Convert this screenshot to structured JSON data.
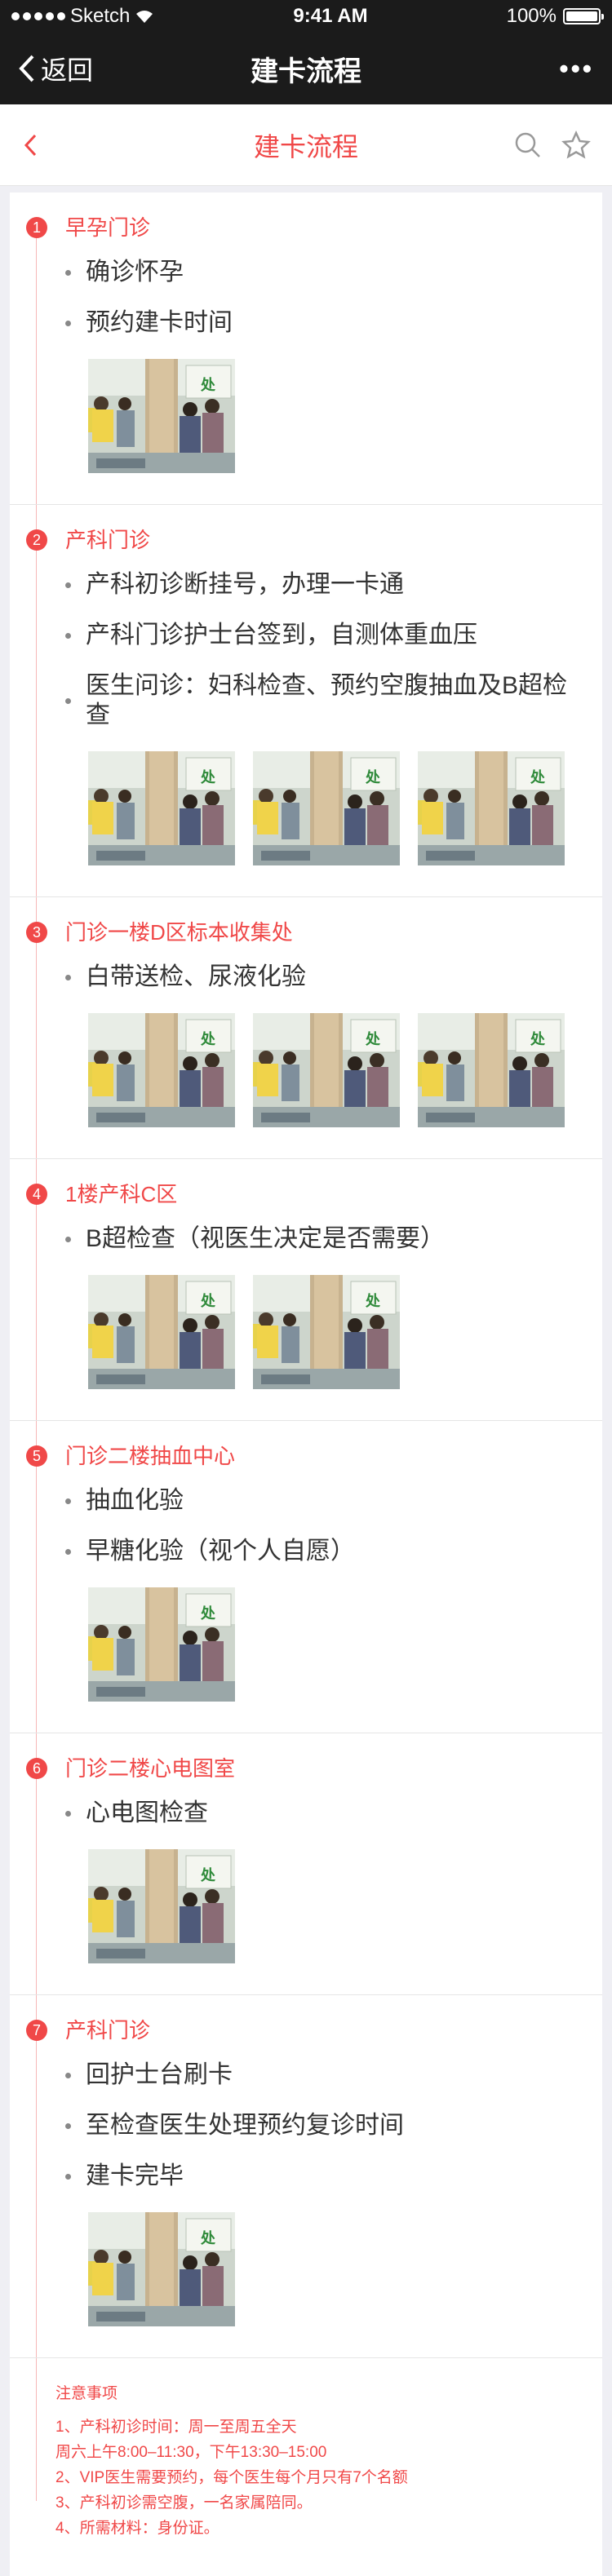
{
  "status": {
    "carrier": "Sketch",
    "time": "9:41 AM",
    "battery": "100%"
  },
  "wechat": {
    "back_label": "返回",
    "title": "建卡流程",
    "more_label": "•••"
  },
  "nav": {
    "title": "建卡流程"
  },
  "steps": [
    {
      "num": "1",
      "title": "早孕门诊",
      "items": [
        "确诊怀孕",
        "预约建卡时间"
      ],
      "photos": 1
    },
    {
      "num": "2",
      "title": "产科门诊",
      "items": [
        "产科初诊断挂号，办理一卡通",
        "产科门诊护士台签到，自测体重血压",
        "医生问诊：妇科检查、预约空腹抽血及B超检查"
      ],
      "photos": 3
    },
    {
      "num": "3",
      "title": "门诊一楼D区标本收集处",
      "items": [
        "白带送检、尿液化验"
      ],
      "photos": 3
    },
    {
      "num": "4",
      "title": "1楼产科C区",
      "items": [
        "B超检查（视医生决定是否需要）"
      ],
      "photos": 2
    },
    {
      "num": "5",
      "title": "门诊二楼抽血中心",
      "items": [
        "抽血化验",
        "早糖化验（视个人自愿）"
      ],
      "photos": 1
    },
    {
      "num": "6",
      "title": "门诊二楼心电图室",
      "items": [
        "心电图检查"
      ],
      "photos": 1
    },
    {
      "num": "7",
      "title": "产科门诊",
      "items": [
        "回护士台刷卡",
        "至检查医生处理预约复诊时间",
        "建卡完毕"
      ],
      "photos": 1
    }
  ],
  "photo_sign": "处",
  "notes": {
    "heading": "注意事项",
    "lines": [
      "1、产科初诊时间：周一至周五全天",
      "周六上午8:00–11:30，下午13:30–15:00",
      "2、VIP医生需要预约，每个医生每个月只有7个名额",
      "3、产科初诊需空腹，一名家属陪同。",
      "4、所需材料：身份证。"
    ]
  },
  "colors": {
    "accent": "#f04848",
    "bar": "#1b1b1b"
  }
}
